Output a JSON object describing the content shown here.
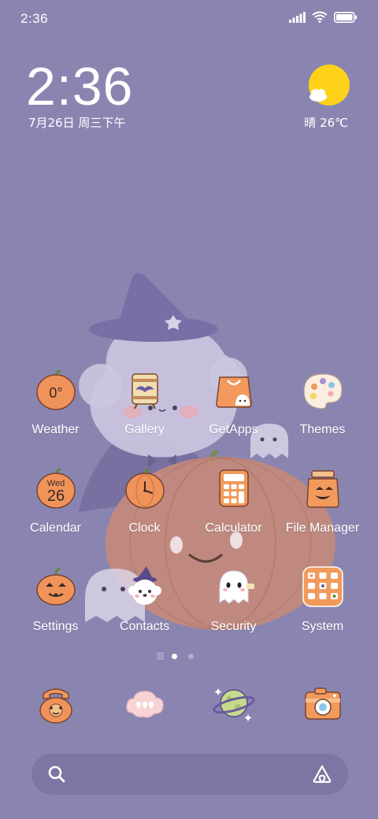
{
  "status_bar": {
    "time": "2:36",
    "icons": [
      "signal-icon",
      "wifi-icon",
      "battery-icon"
    ]
  },
  "clock_widget": {
    "time": "2:36",
    "date": "7月26日 周三下午",
    "weather_icon": "sun-cloud-icon",
    "weather_text": "晴 26℃"
  },
  "home_apps": [
    {
      "label": "Weather",
      "icon": "weather-pumpkin-icon",
      "icon_text": "0°"
    },
    {
      "label": "Gallery",
      "icon": "gallery-easel-icon"
    },
    {
      "label": "GetApps",
      "icon": "getapps-bag-icon"
    },
    {
      "label": "Themes",
      "icon": "themes-palette-icon"
    },
    {
      "label": "Calendar",
      "icon": "calendar-pumpkin-icon",
      "icon_day": "Wed",
      "icon_date": "26"
    },
    {
      "label": "Clock",
      "icon": "clock-pumpkin-icon"
    },
    {
      "label": "Calculator",
      "icon": "calculator-icon"
    },
    {
      "label": "File Manager",
      "icon": "file-manager-jar-icon"
    },
    {
      "label": "Settings",
      "icon": "settings-jack-o-lantern-icon"
    },
    {
      "label": "Contacts",
      "icon": "contacts-puppy-icon"
    },
    {
      "label": "Security",
      "icon": "security-ghost-icon"
    },
    {
      "label": "System",
      "icon": "system-folder-icon"
    }
  ],
  "page_indicator": {
    "items": [
      "feed-lines-icon",
      "page-dot",
      "page-dot"
    ],
    "active_index": 1
  },
  "dock": [
    {
      "icon": "phone-icon"
    },
    {
      "icon": "messages-icon"
    },
    {
      "icon": "browser-planet-icon"
    },
    {
      "icon": "camera-icon"
    }
  ],
  "search_bar": {
    "search_icon": "search-icon",
    "right_icon": "app-vault-icon"
  },
  "colors": {
    "background": "#8a85b0",
    "search_bar": "#7b76a3",
    "text": "#ffffff",
    "sun": "#ffd21a",
    "pumpkin": "#f0935a"
  }
}
